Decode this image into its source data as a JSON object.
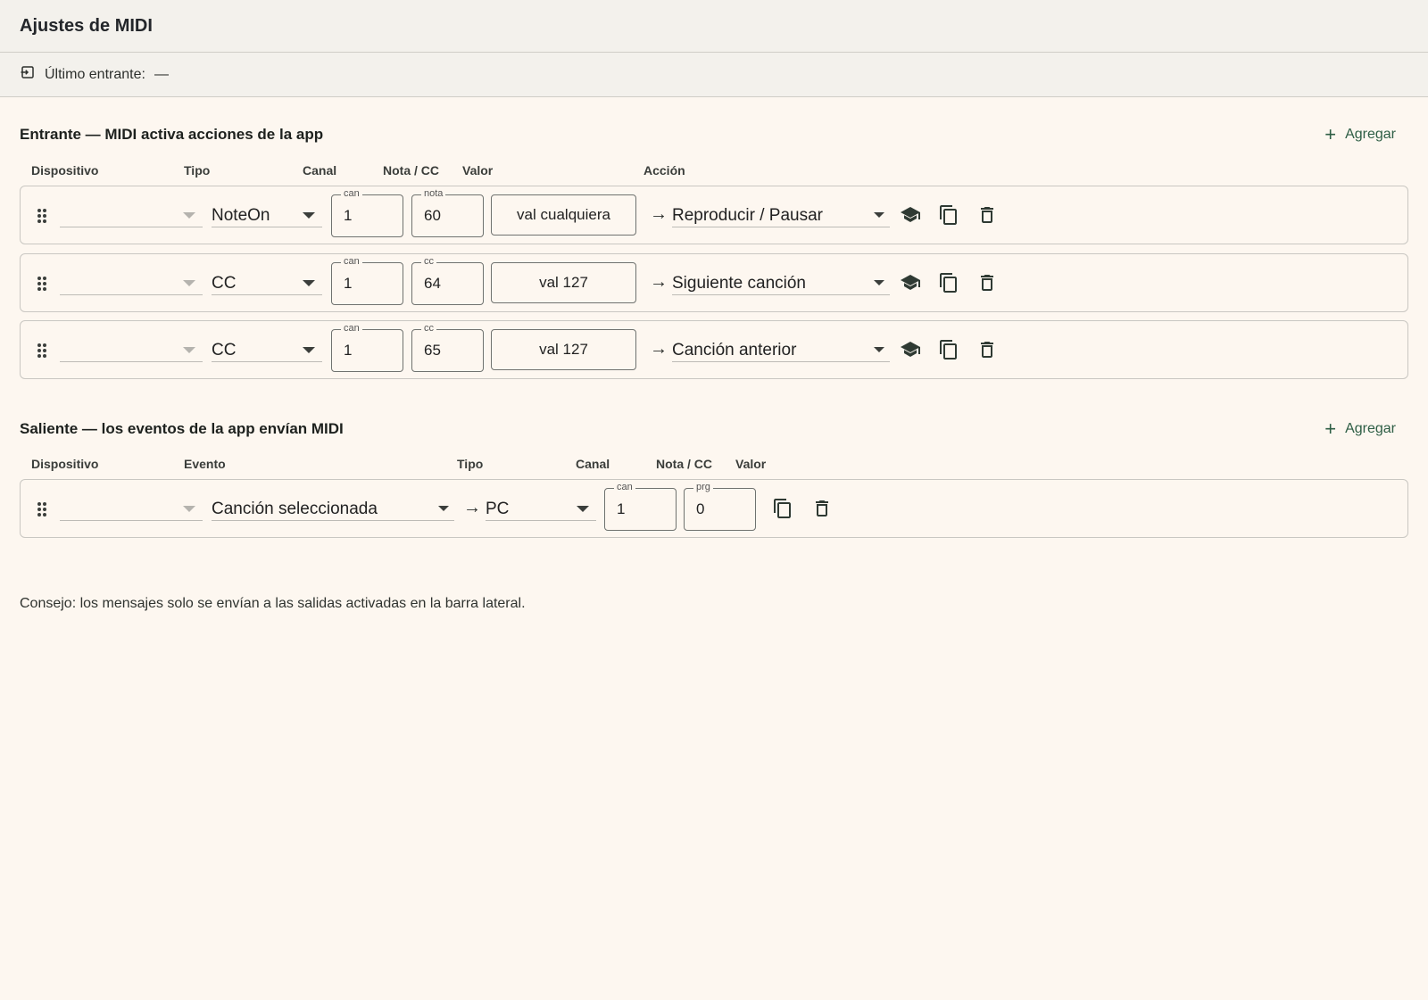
{
  "header": {
    "title": "Ajustes de MIDI"
  },
  "status": {
    "label": "Último entrante:",
    "value": "—"
  },
  "incoming": {
    "title": "Entrante — MIDI activa acciones de la app",
    "add_label": "Agregar",
    "columns": [
      "Dispositivo",
      "Tipo",
      "Canal",
      "Nota / CC",
      "Valor",
      "Acción"
    ],
    "rows": [
      {
        "device": "",
        "type": "NoteOn",
        "channel_label": "can",
        "channel": "1",
        "num_label": "nota",
        "num": "60",
        "value": "val cualquiera",
        "arrow": "→",
        "action": "Reproducir / Pausar"
      },
      {
        "device": "",
        "type": "CC",
        "channel_label": "can",
        "channel": "1",
        "num_label": "cc",
        "num": "64",
        "value": "val 127",
        "arrow": "→",
        "action": "Siguiente canción"
      },
      {
        "device": "",
        "type": "CC",
        "channel_label": "can",
        "channel": "1",
        "num_label": "cc",
        "num": "65",
        "value": "val 127",
        "arrow": "→",
        "action": "Canción anterior"
      }
    ]
  },
  "outgoing": {
    "title": "Saliente — los eventos de la app envían MIDI",
    "add_label": "Agregar",
    "columns": [
      "Dispositivo",
      "Evento",
      "Tipo",
      "Canal",
      "Nota / CC",
      "Valor"
    ],
    "rows": [
      {
        "device": "",
        "event": "Canción seleccionada",
        "arrow": "→",
        "type": "PC",
        "channel_label": "can",
        "channel": "1",
        "num_label": "prg",
        "num": "0"
      }
    ]
  },
  "tip": "Consejo: los mensajes solo se envían a las salidas activadas en la barra lateral.",
  "icons": {
    "learn": "school-cap-icon",
    "duplicate": "copy-icon",
    "delete": "trash-icon",
    "drag": "drag-handle-icon",
    "status": "input-icon"
  },
  "colors": {
    "accent": "#2e5e45",
    "background": "#fdf7f0",
    "header_bg": "#f3f1ec"
  }
}
